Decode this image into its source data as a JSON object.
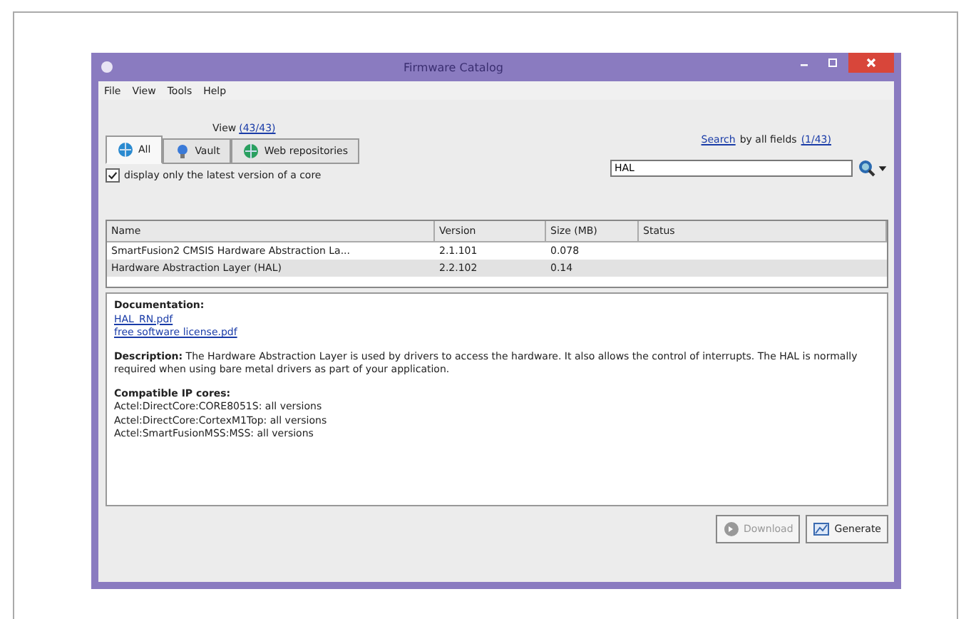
{
  "window": {
    "title": "Firmware Catalog"
  },
  "menu": [
    "File",
    "View",
    "Tools",
    "Help"
  ],
  "view": {
    "label": "View",
    "count": "(43/43)"
  },
  "tabs": [
    {
      "label": "All",
      "selected": true
    },
    {
      "label": "Vault",
      "selected": false
    },
    {
      "label": "Web repositories",
      "selected": false
    }
  ],
  "latest_only": {
    "label": "display only the latest version of a core",
    "checked": true
  },
  "search": {
    "link": "Search",
    "label": "by all fields",
    "count": "(1/43)",
    "value": "HAL"
  },
  "table": {
    "columns": [
      "Name",
      "Version",
      "Size (MB)",
      "Status"
    ],
    "rows": [
      {
        "cells": [
          "SmartFusion2 CMSIS Hardware Abstraction La...",
          "2.1.101",
          "0.078",
          ""
        ],
        "selected": false
      },
      {
        "cells": [
          "Hardware Abstraction Layer (HAL)",
          "2.2.102",
          "0.14",
          ""
        ],
        "selected": true
      }
    ]
  },
  "details": {
    "documentation_heading": "Documentation:",
    "documents": [
      "HAL_RN.pdf",
      "free software license.pdf"
    ],
    "description": "**Description:** The Hardware Abstraction Layer is used by drivers to access the hardware. It also allows the control of interrupts. The HAL is normally required when using bare metal drivers as part of your application.",
    "cores_heading": "Compatible IP cores:",
    "cores": [
      "Actel:DirectCore:CORE8051S: all versions",
      "Actel:DirectCore:CortexM1Top: all versions",
      "Actel:SmartFusionMSS:MSS: all versions"
    ]
  },
  "buttons": [
    {
      "label": "Download",
      "disabled": true,
      "kind": "download"
    },
    {
      "label": "Generate",
      "disabled": false,
      "kind": "generate"
    }
  ]
}
